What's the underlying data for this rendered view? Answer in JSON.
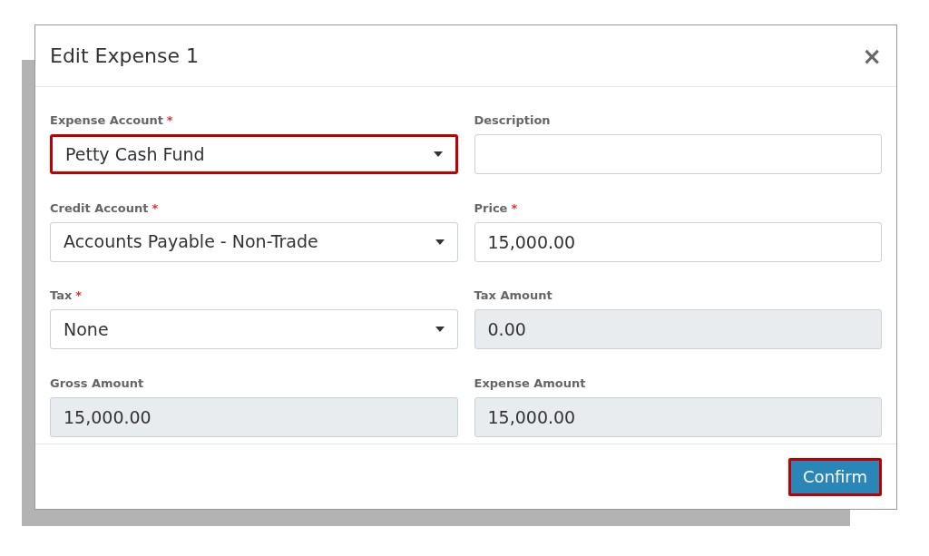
{
  "dialog": {
    "title": "Edit Expense 1",
    "close": "×"
  },
  "fields": [
    {
      "label": "Expense Account",
      "required_mark": "*",
      "kind": "select",
      "value": "Petty Cash Fund",
      "highlighted": true
    },
    {
      "label": "Description",
      "kind": "input",
      "highlighted": false
    },
    {
      "label": "Credit Account",
      "required_mark": "*",
      "kind": "select",
      "value": "Accounts Payable - Non-Trade",
      "highlighted": false
    },
    {
      "label": "Price",
      "required_mark": "*",
      "kind": "input",
      "value": "15,000.00",
      "highlighted": false
    },
    {
      "label": "Tax",
      "required_mark": "*",
      "kind": "select",
      "value": "None",
      "highlighted": false
    },
    {
      "label": "Tax Amount",
      "kind": "readonly",
      "value": "0.00",
      "highlighted": false
    },
    {
      "label": "Gross Amount",
      "kind": "readonly",
      "value": "15,000.00",
      "highlighted": false
    },
    {
      "label": "Expense Amount",
      "kind": "readonly",
      "value": "15,000.00",
      "highlighted": false
    }
  ],
  "confirm": {
    "label": "Confirm",
    "highlighted": true
  }
}
